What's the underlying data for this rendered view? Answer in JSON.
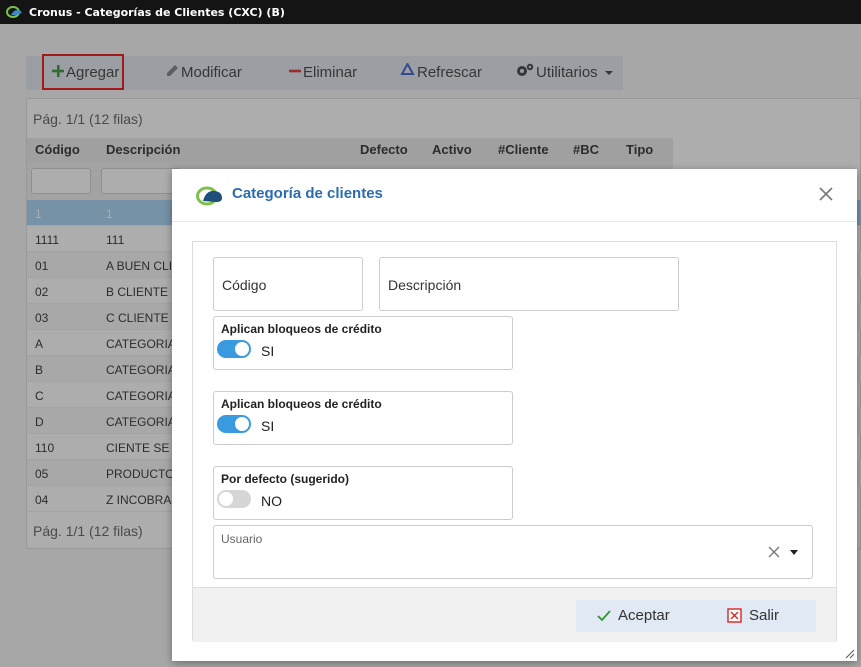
{
  "window": {
    "title": "Cronus - Categorías de Clientes (CXC) (B)"
  },
  "toolbar": {
    "add_label": "Agregar",
    "edit_label": "Modificar",
    "delete_label": "Eliminar",
    "refresh_label": "Refrescar",
    "utils_label": "Utilitarios"
  },
  "grid": {
    "pagination_top": "Pág. 1/1 (12 filas)",
    "pagination_bottom": "Pág. 1/1 (12 filas)",
    "columns": [
      "Código",
      "Descripción",
      "Defecto",
      "Activo",
      "#Cliente",
      "#BC",
      "Tipo"
    ],
    "rows": [
      {
        "code": "1",
        "desc": "1"
      },
      {
        "code": "1111",
        "desc": "111"
      },
      {
        "code": "01",
        "desc": "A BUEN CLI"
      },
      {
        "code": "02",
        "desc": "B CLIENTE"
      },
      {
        "code": "03",
        "desc": "C CLIENTE"
      },
      {
        "code": "A",
        "desc": "CATEGORIA"
      },
      {
        "code": "B",
        "desc": "CATEGORIA"
      },
      {
        "code": "C",
        "desc": "CATEGORIA"
      },
      {
        "code": "D",
        "desc": "CATEGORIA"
      },
      {
        "code": "110",
        "desc": "CIENTE SE"
      },
      {
        "code": "05",
        "desc": "PRODUCTO"
      },
      {
        "code": "04",
        "desc": "Z INCOBRA"
      }
    ]
  },
  "modal": {
    "title": "Categoría de clientes",
    "code_placeholder": "Código",
    "desc_placeholder": "Descripción",
    "switch1": {
      "label": "Aplican bloqueos de crédito",
      "value": "SI"
    },
    "switch2": {
      "label": "Aplican bloqueos de crédito",
      "value": "SI"
    },
    "switch3": {
      "label": "Por defecto (sugerido)",
      "value": "NO"
    },
    "user_label": "Usuario",
    "accept_label": "Aceptar",
    "exit_label": "Salir"
  }
}
